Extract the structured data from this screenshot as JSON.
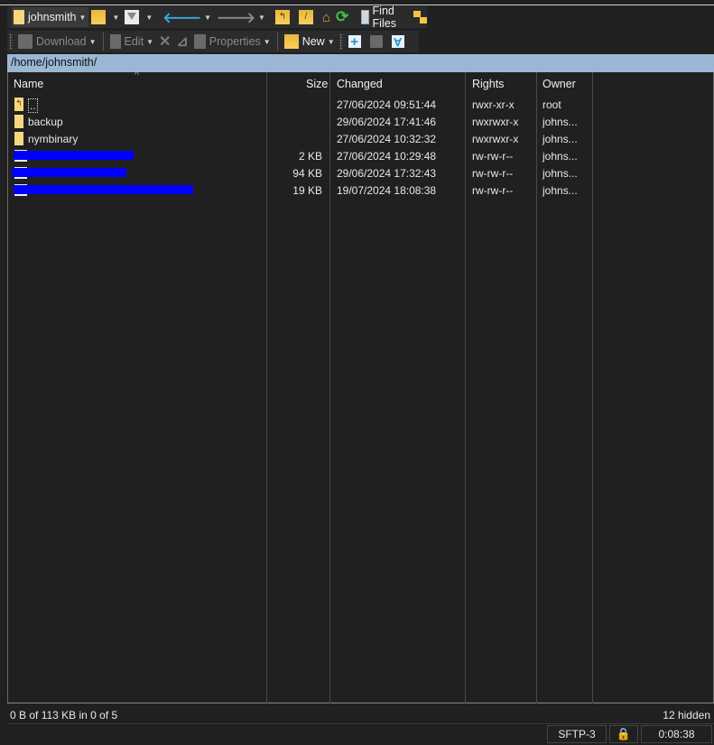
{
  "toolbar1": {
    "location_combo": "johnsmith",
    "find_files_label": "Find Files",
    "icons": [
      "folder-icon",
      "open-folder-icon",
      "filter-icon",
      "back-arrow-icon",
      "forward-arrow-icon",
      "parent-directory-icon",
      "root-directory-icon",
      "home-icon",
      "refresh-icon",
      "find-files-icon",
      "synchronize-icon"
    ]
  },
  "toolbar2": {
    "download_label": "Download",
    "edit_label": "Edit",
    "properties_label": "Properties",
    "new_label": "New",
    "icons": [
      "download-icon",
      "edit-icon",
      "delete-icon",
      "rename-icon",
      "properties-icon",
      "new-icon",
      "select-icon",
      "unselect-icon",
      "select-all-icon"
    ]
  },
  "path": "/home/johnsmith/",
  "columns": {
    "name": "Name",
    "size": "Size",
    "changed": "Changed",
    "rights": "Rights",
    "owner": "Owner"
  },
  "files": [
    {
      "name": "..",
      "type": "parent",
      "size": "",
      "changed": "27/06/2024 09:51:44",
      "rights": "rwxr-xr-x",
      "owner": "root"
    },
    {
      "name": "backup",
      "type": "folder",
      "size": "",
      "changed": "29/06/2024 17:41:46",
      "rights": "rwxrwxr-x",
      "owner": "johns..."
    },
    {
      "name": "nymbinary",
      "type": "folder",
      "size": "",
      "changed": "27/06/2024 10:32:32",
      "rights": "rwxrwxr-x",
      "owner": "johns..."
    },
    {
      "name": "[redacted]",
      "type": "file",
      "size": "2 KB",
      "changed": "27/06/2024 10:29:48",
      "rights": "rw-rw-r--",
      "owner": "johns..."
    },
    {
      "name": "[redacted]",
      "type": "file",
      "size": "94 KB",
      "changed": "29/06/2024 17:32:43",
      "rights": "rw-rw-r--",
      "owner": "johns..."
    },
    {
      "name": "[redacted]",
      "type": "file",
      "size": "19 KB",
      "changed": "19/07/2024 18:08:38",
      "rights": "rw-rw-r--",
      "owner": "johns..."
    }
  ],
  "status": {
    "selection": "0 B of 113 KB in 0 of 5",
    "hidden": "12 hidden",
    "protocol": "SFTP-3",
    "elapsed": "0:08:38"
  },
  "colors": {
    "path_bar": "#9bb7d4",
    "redaction": "#0000ff",
    "folder": "#f5d77e"
  }
}
